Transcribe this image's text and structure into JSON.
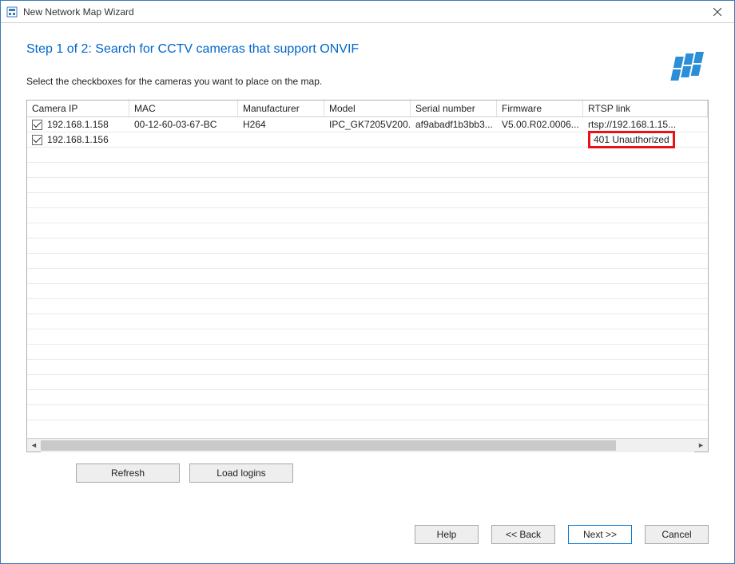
{
  "window": {
    "title": "New Network Map Wizard"
  },
  "step": {
    "title": "Step 1 of 2: Search for CCTV cameras that support ONVIF",
    "instruction": "Select the checkboxes for the cameras you want to place on the map."
  },
  "grid": {
    "columns": {
      "ip": "Camera IP",
      "mac": "MAC",
      "manufacturer": "Manufacturer",
      "model": "Model",
      "serial": "Serial number",
      "firmware": "Firmware",
      "rtsp": "RTSP link"
    },
    "rows": [
      {
        "checked": true,
        "ip": "192.168.1.158",
        "mac": "00-12-60-03-67-BC",
        "manufacturer": "H264",
        "model": "IPC_GK7205V200...",
        "serial": "af9abadf1b3bb3...",
        "firmware": "V5.00.R02.0006...",
        "rtsp": "rtsp://192.168.1.15..."
      },
      {
        "checked": true,
        "ip": "192.168.1.156",
        "mac": "",
        "manufacturer": "",
        "model": "",
        "serial": "",
        "firmware": "",
        "rtsp": "401 Unauthorized",
        "rtsp_highlight": true
      }
    ]
  },
  "buttons": {
    "refresh": "Refresh",
    "load_logins": "Load logins",
    "help": "Help",
    "back": "<< Back",
    "next": "Next >>",
    "cancel": "Cancel"
  }
}
